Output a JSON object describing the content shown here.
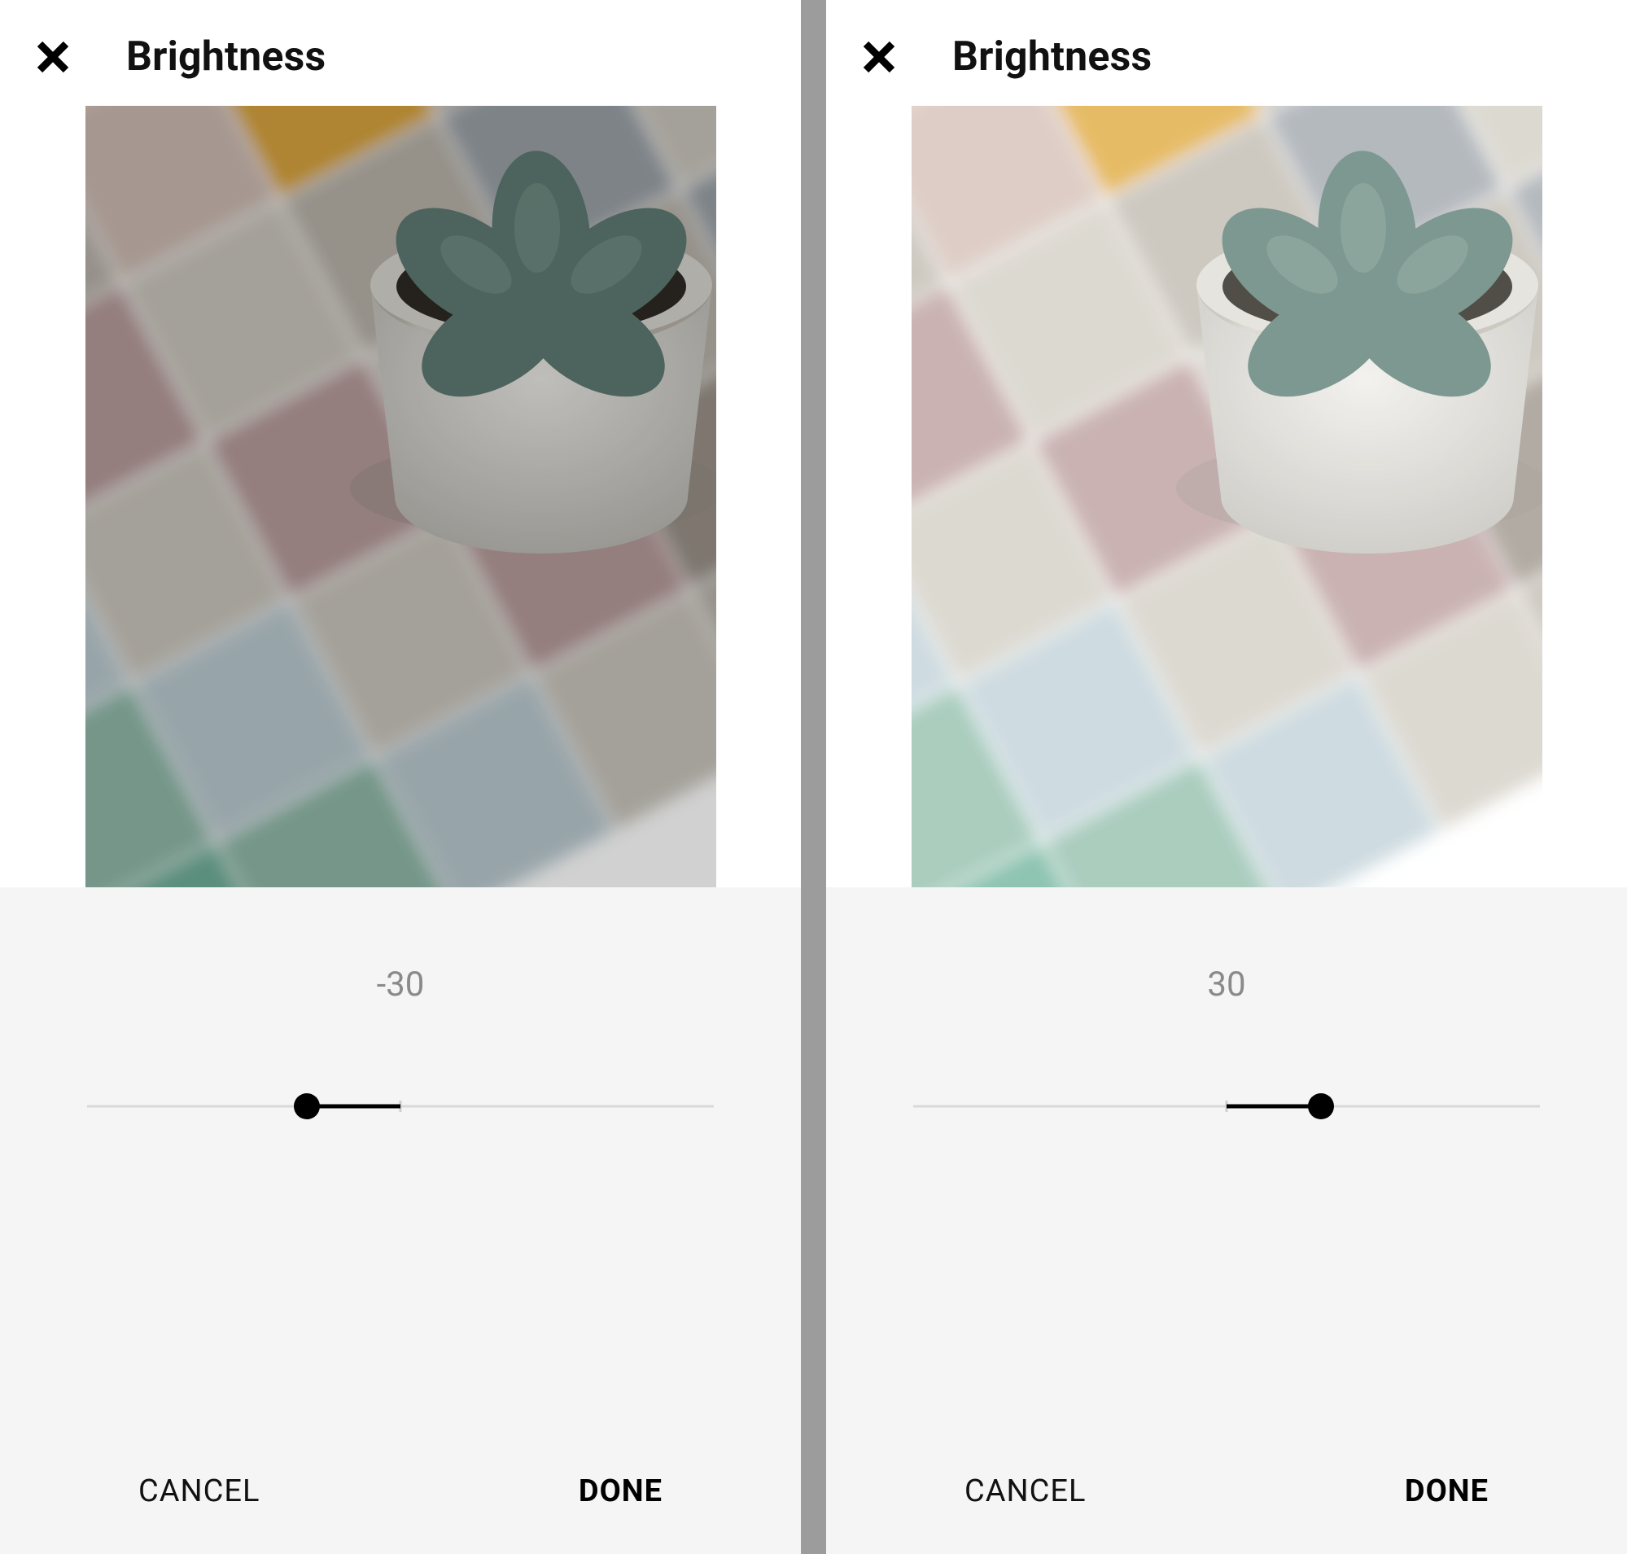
{
  "slider": {
    "min": -100,
    "max": 100
  },
  "screens": [
    {
      "title": "Brightness",
      "value": -30,
      "value_label": "-30",
      "cancel_label": "CANCEL",
      "done_label": "DONE",
      "brightness_overlay": "rgba(0,0,0,0.18)"
    },
    {
      "title": "Brightness",
      "value": 30,
      "value_label": "30",
      "cancel_label": "CANCEL",
      "done_label": "DONE",
      "brightness_overlay": "rgba(255,255,255,0.12)"
    }
  ]
}
